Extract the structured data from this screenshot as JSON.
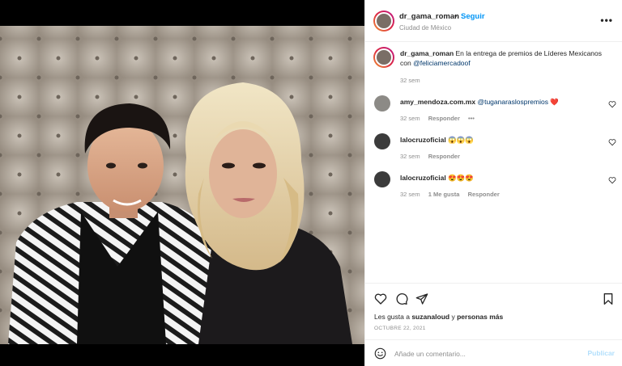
{
  "post": {
    "username": "dr_gama_roman",
    "dot": "•",
    "follow_label": "Seguir",
    "location": "Ciudad de México",
    "more_label": "•••"
  },
  "caption": {
    "username": "dr_gama_roman",
    "text": "En la entrega de premios de Líderes Mexicanos con",
    "mention": "@feliciamercadoof",
    "time": "32 sem"
  },
  "comments": [
    {
      "username": "amy_mendoza.com.mx",
      "mention": "@tuganaraslospremios",
      "text": " ❤️",
      "time": "32 sem",
      "likes": "",
      "reply_label": "Responder",
      "more": "•••"
    },
    {
      "username": "lalocruzoficial",
      "mention": "",
      "text": "😱😱😱",
      "time": "32 sem",
      "likes": "",
      "reply_label": "Responder",
      "more": ""
    },
    {
      "username": "lalocruzoficial",
      "mention": "",
      "text": "😍😍😍",
      "time": "32 sem",
      "likes": "1 Me gusta",
      "reply_label": "Responder",
      "more": ""
    }
  ],
  "likes": {
    "prefix": "Les gusta a",
    "user": "suzanaloud",
    "connector": "y",
    "others": "personas más"
  },
  "date": "OCTUBRE 22, 2021",
  "add_comment": {
    "placeholder": "Añade un comentario...",
    "publish_label": "Publicar"
  },
  "icons": {
    "like": "heart-icon",
    "comment": "comment-bubble-icon",
    "share": "paper-plane-icon",
    "save": "bookmark-icon",
    "emoji": "smiley-icon"
  },
  "colors": {
    "link_blue": "#0095f6",
    "mention_blue": "#00376b",
    "heart_red": "#ed4956",
    "publish_disabled": "#b2dffc",
    "photo_background": "#a79d91"
  }
}
